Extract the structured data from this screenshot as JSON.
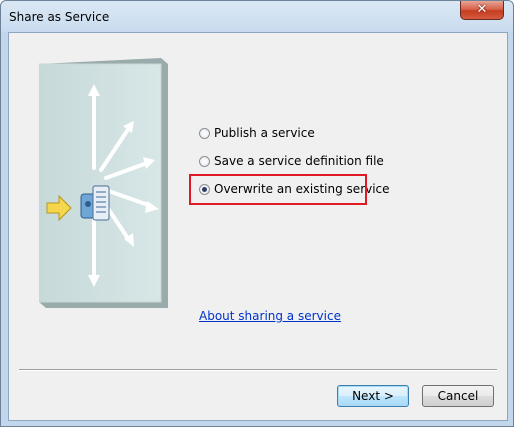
{
  "window": {
    "title": "Share as Service"
  },
  "options": [
    {
      "label": "Publish a service",
      "checked": false
    },
    {
      "label": "Save a service definition file",
      "checked": false
    },
    {
      "label": "Overwrite an existing service",
      "checked": true
    }
  ],
  "link": {
    "label": "About sharing a service"
  },
  "buttons": {
    "next": "Next >",
    "cancel": "Cancel"
  },
  "icons": {
    "close": "close-icon",
    "graphic": "share-service-graphic"
  },
  "colors": {
    "highlight": "#e01a22",
    "link": "#0033cc",
    "panel": "#cfe0e0"
  }
}
